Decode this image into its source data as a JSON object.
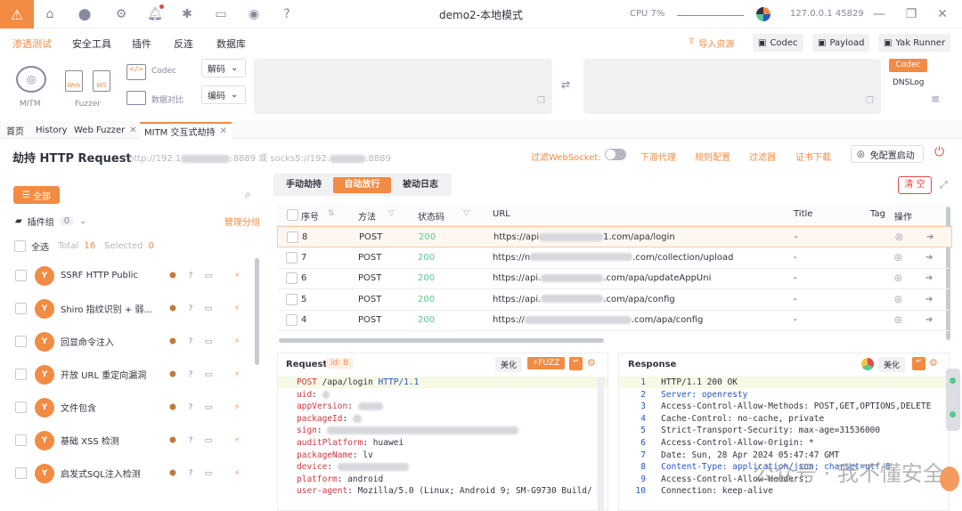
{
  "titlebar": {
    "app_title": "demo2-本地模式",
    "cpu": "CPU 7%",
    "engine": "127.0.0.1 45829"
  },
  "menu": {
    "items": [
      "渗透测试",
      "安全工具",
      "插件",
      "反连",
      "数据库"
    ],
    "active": "渗透测试",
    "import": "导入资源",
    "codec": "Codec",
    "payload": "Payload",
    "yak_runner": "Yak Runner"
  },
  "toolbar": {
    "mitm": "MITM",
    "fuzzer": "Fuzzer",
    "codec": "Codec",
    "compare": "数据对比",
    "decode": "解码",
    "encode": "编码",
    "codec_tag": "Codec",
    "dnslog": "DNSLog",
    "web": "Web",
    "ws": "WS"
  },
  "tabs": [
    "首页",
    "History",
    "Web Fuzzer",
    "MITM 交互式劫持"
  ],
  "header": {
    "title": "劫持 HTTP Request",
    "proxy_prefix": "http://192.1",
    "proxy_mid": ":8889 或 socks5://192.",
    "proxy_suffix": ":8889",
    "filter_ws": "过滤WebSocket:",
    "downstream": "下游代理",
    "rules": "规则配置",
    "filter": "过滤器",
    "cert": "证书下载",
    "no_config": "免配置启动"
  },
  "left": {
    "all": "全部",
    "plugin_group": "插件组",
    "group_count": "0",
    "manage": "管理分组",
    "select_all": "全选",
    "total_label": "Total",
    "total": "16",
    "selected_label": "Selected",
    "selected": "0",
    "plugins": [
      "SSRF HTTP Public",
      "Shiro 指纹识别 + 弱密...",
      "回显命令注入",
      "开放 URL 重定向漏洞",
      "文件包含",
      "基础 XSS 检测",
      "启发式SQL注入检测"
    ]
  },
  "mode_tabs": [
    "手动劫持",
    "自动放行",
    "被动日志"
  ],
  "active_mode": "自动放行",
  "clear": "清 空",
  "table": {
    "headers": [
      "序号",
      "方法",
      "状态码",
      "URL",
      "Title",
      "Tag",
      "操作"
    ],
    "rows": [
      {
        "id": "8",
        "method": "POST",
        "status": "200",
        "url_a": "https://api",
        "url_b": "1.com/apa/login",
        "title": "-"
      },
      {
        "id": "7",
        "method": "POST",
        "status": "200",
        "url_a": "https://n",
        "url_b": ".com/collection/upload",
        "title": "-"
      },
      {
        "id": "6",
        "method": "POST",
        "status": "200",
        "url_a": "https://api.",
        "url_b": ".com/apa/updateAppUni",
        "title": "-"
      },
      {
        "id": "5",
        "method": "POST",
        "status": "200",
        "url_a": "https://api.",
        "url_b": ".com/apa/config",
        "title": "-"
      },
      {
        "id": "4",
        "method": "POST",
        "status": "200",
        "url_a": "https://",
        "url_b": ".com/apa/config",
        "title": "-"
      }
    ]
  },
  "request": {
    "label": "Request",
    "id_tag": "id: 8",
    "beautify": "美化",
    "fuzz": "FUZZ",
    "lines": [
      {
        "k": "POST",
        "v": " /apa/login ",
        "k2": "HTTP/1.1"
      },
      {
        "k": "uid",
        "v": ": "
      },
      {
        "k": "appVersion",
        "v": ": "
      },
      {
        "k": "packageId",
        "v": ": "
      },
      {
        "k": "sign",
        "v": ": "
      },
      {
        "k": "auditPlatform",
        "v": ": huawei"
      },
      {
        "k": "packageName",
        "v": ": lv"
      },
      {
        "k": "device",
        "v": ": "
      },
      {
        "k": "platform",
        "v": ": android"
      },
      {
        "k": "user-agent",
        "v": ": Mozilla/5.0 (Linux; Android 9; SM-G9730 Build/"
      }
    ]
  },
  "response": {
    "label": "Response",
    "beautify": "美化",
    "lines": [
      {
        "n": "1",
        "t": "HTTP/1.1 200 OK"
      },
      {
        "n": "2",
        "t": "Server: openresty"
      },
      {
        "n": "3",
        "t": "Access-Control-Allow-Methods: POST,GET,OPTIONS,DELETE"
      },
      {
        "n": "4",
        "t": "Cache-Control: no-cache, private"
      },
      {
        "n": "5",
        "t": "Strict-Transport-Security: max-age=31536000"
      },
      {
        "n": "6",
        "t": "Access-Control-Allow-Origin: *"
      },
      {
        "n": "7",
        "t": "Date: Sun, 28 Apr 2024 05:47:47 GMT"
      },
      {
        "n": "8",
        "t": "Content-Type: application/json; charset=utf-8"
      },
      {
        "n": "9",
        "t": "Access-Control-Allow-Headers: "
      },
      {
        "n": "10",
        "t": "Connection: keep-alive"
      }
    ]
  },
  "watermark": "公众号 · 我不懂安全"
}
